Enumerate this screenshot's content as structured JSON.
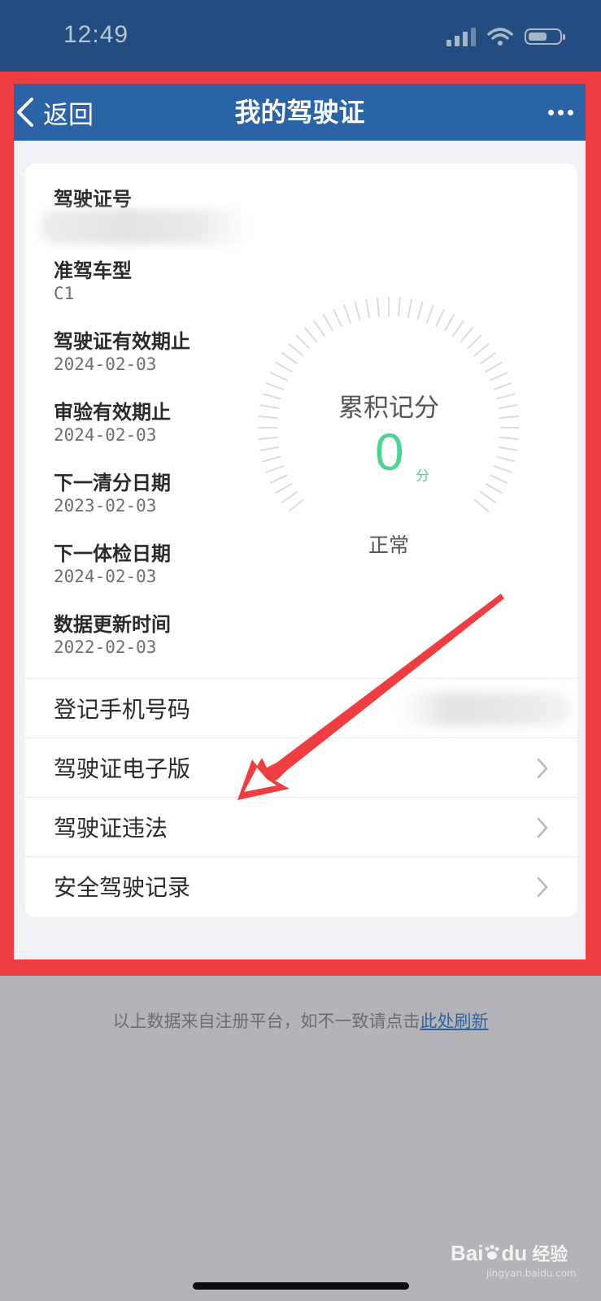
{
  "status_bar": {
    "time": "12:49"
  },
  "nav": {
    "back_label": "返回",
    "title": "我的驾驶证"
  },
  "license_info": [
    {
      "label": "驾驶证号",
      "value": ""
    },
    {
      "label": "准驾车型",
      "value": "C1"
    },
    {
      "label": "驾驶证有效期止",
      "value": "2024-02-03"
    },
    {
      "label": "审验有效期止",
      "value": "2024-02-03"
    },
    {
      "label": "下一清分日期",
      "value": "2023-02-03"
    },
    {
      "label": "下一体检日期",
      "value": "2024-02-03"
    },
    {
      "label": "数据更新时间",
      "value": "2022-02-03"
    }
  ],
  "score_gauge": {
    "title": "累积记分",
    "value": "0",
    "unit": "分",
    "status": "正常",
    "accent": "#4cd492"
  },
  "menu_rows": [
    {
      "label": "登记手机号码"
    },
    {
      "label": "驾驶证电子版"
    },
    {
      "label": "驾驶证违法"
    },
    {
      "label": "安全驾驶记录"
    }
  ],
  "footer": {
    "note": "以上数据来自注册平台，如不一致请点击",
    "link": "此处刷新"
  },
  "watermark": {
    "brand": "Bai",
    "brand_suffix": "du",
    "cn": "经验",
    "url": "jingyan.baidu.com"
  },
  "colors": {
    "nav_bg": "#2b64a6",
    "status_bg": "#234c80",
    "highlight_frame": "#ef3e42",
    "link": "#2b64a6"
  }
}
